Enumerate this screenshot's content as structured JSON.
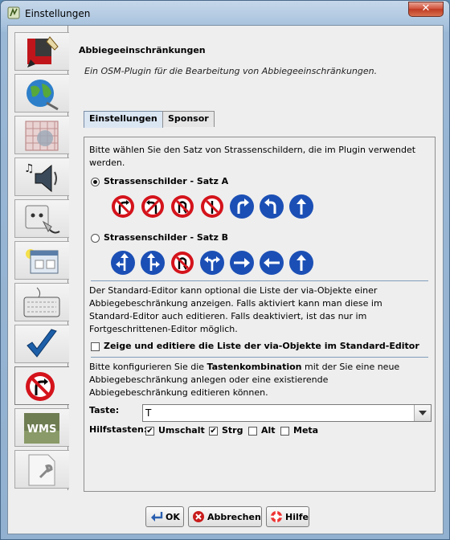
{
  "window": {
    "title": "Einstellungen",
    "close_label": "✕"
  },
  "sidebar": {
    "items": [
      {
        "name": "display-settings-tab",
        "icon": "paint-brush-icon"
      },
      {
        "name": "map-settings-tab",
        "icon": "globe-icon"
      },
      {
        "name": "projection-settings-tab",
        "icon": "grid-icon"
      },
      {
        "name": "audio-settings-tab",
        "icon": "speaker-icon"
      },
      {
        "name": "connection-settings-tab",
        "icon": "plug-icon"
      },
      {
        "name": "plugin-settings-tab",
        "icon": "window-icon"
      },
      {
        "name": "shortcut-settings-tab",
        "icon": "keyboard-icon"
      },
      {
        "name": "validator-settings-tab",
        "icon": "checkmark-icon"
      },
      {
        "name": "turnrestrictions-settings-tab",
        "icon": "no-turn-sign-icon",
        "selected": true
      },
      {
        "name": "wms-settings-tab",
        "icon": "wms-icon",
        "label": "WMS"
      },
      {
        "name": "advanced-settings-tab",
        "icon": "document-wrench-icon"
      }
    ]
  },
  "header": {
    "title": "Abbiegeeinschränkungen",
    "description": "Ein OSM-Plugin für die Bearbeitung von Abbiegeeinschränkungen."
  },
  "tabs": [
    {
      "label": "Einstellungen",
      "selected": true
    },
    {
      "label": "Sponsor",
      "selected": false
    }
  ],
  "panel": {
    "intro": [
      "Bitte wählen Sie den Satz von Strassenschildern, die im Plugin verwendet",
      "werden."
    ],
    "set_a_label": "Strassenschilder - Satz A",
    "set_b_label": "Strassenschilder - Satz B",
    "set_a_selected": true,
    "editor_text": [
      "Der Standard-Editor kann optional die Liste der via-Objekte einer",
      "Abbiegebeschränkung anzeigen. Falls aktiviert kann man diese im",
      "Standard-Editor auch editieren. Falls deaktiviert, ist das nur im",
      "Fortgeschrittenen-Editor möglich."
    ],
    "via_checkbox_label": "Zeige und editiere die Liste der via-Objekte im Standard-Editor",
    "via_checked": false,
    "shortcut_text_1": "Bitte konfigurieren Sie die ",
    "shortcut_text_bold": "Tastenkombination",
    "shortcut_text_2": " mit der Sie eine neue",
    "shortcut_text_3": "Abbiegebeschränkung anlegen oder eine existierende",
    "shortcut_text_4": "Abbiegebeschränkung editieren können.",
    "key_label": "Taste:",
    "key_value": "T",
    "modifiers_label": "Hilfstasten:",
    "modifiers": [
      {
        "label": "Umschalt",
        "checked": true
      },
      {
        "label": "Strg",
        "checked": true
      },
      {
        "label": "Alt",
        "checked": false
      },
      {
        "label": "Meta",
        "checked": false
      }
    ]
  },
  "buttons": {
    "ok": "OK",
    "cancel": "Abbrechen",
    "help": "Hilfe"
  },
  "colors": {
    "sign_red": "#d4131b",
    "sign_blue": "#1b4fb5",
    "accent": "#7f9db9"
  }
}
